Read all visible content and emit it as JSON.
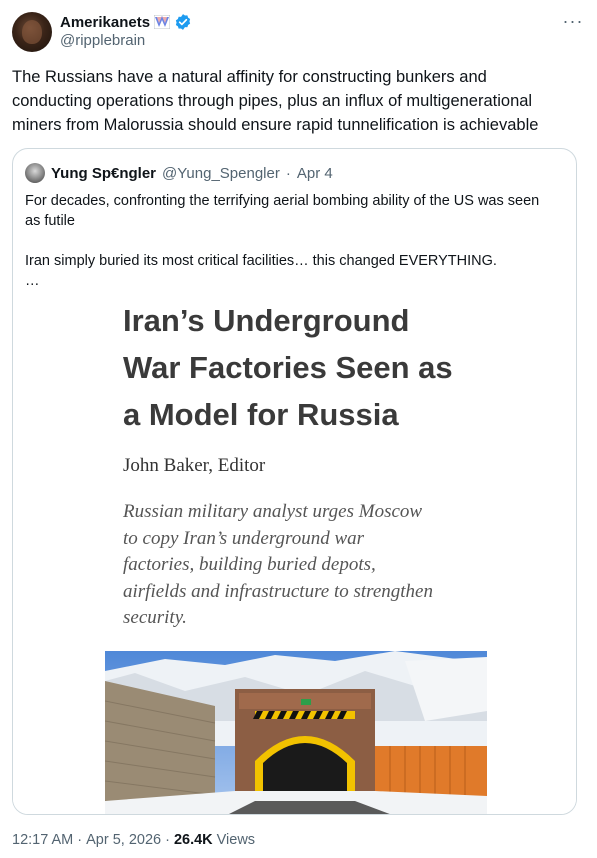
{
  "author": {
    "display_name": "Amerikanets",
    "handle": "@ripplebrain",
    "flag_icon": "flag-icon",
    "verified_icon": "verified-badge-icon",
    "verified_color": "#1d9bf0"
  },
  "more_label": "···",
  "tweet": {
    "text_lines": [
      "The Russians have a natural affinity for constructing bunkers and",
      "conducting operations through pipes, plus an influx of multigenerational",
      "miners from Malorussia should ensure rapid tunnelification is achievable"
    ]
  },
  "quote": {
    "name": "Yung Sp€ngler",
    "handle": "@Yung_Spengler",
    "separator": "·",
    "date": "Apr 4",
    "lines": [
      "For decades, confronting the terrifying aerial bombing ability of the US was seen",
      "as futile",
      "Iran simply buried its most critical facilities… this changed EVERYTHING."
    ],
    "ellipsis": "…"
  },
  "article": {
    "headline_lines": [
      "Iran’s Underground",
      "War Factories Seen as",
      "a Model for Russia"
    ],
    "author": "John Baker, Editor",
    "deck_lines": [
      "Russian military analyst urges Moscow",
      "to copy Iran’s underground war",
      "factories, building buried depots,",
      "airfields and infrastructure to strengthen",
      "security."
    ]
  },
  "meta": {
    "time": "12:17 AM",
    "dot1": "·",
    "date": "Apr 5, 2026",
    "dot2": "·",
    "views_count": "26.4K",
    "views_label": "Views"
  }
}
